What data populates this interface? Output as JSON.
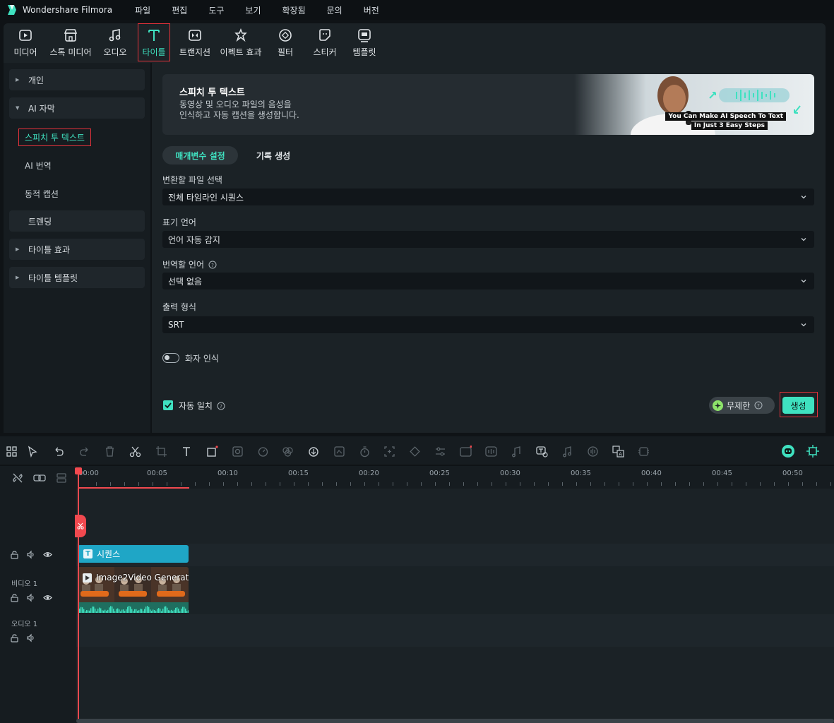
{
  "app": {
    "name": "Wondershare Filmora",
    "menu": [
      "파일",
      "편집",
      "도구",
      "보기",
      "확장됨",
      "문의",
      "버전"
    ]
  },
  "toolbar": {
    "items": [
      {
        "label": "미디어",
        "icon": "media-icon"
      },
      {
        "label": "스톡 미디어",
        "icon": "stock-media-icon"
      },
      {
        "label": "오디오",
        "icon": "music-note-icon"
      },
      {
        "label": "타이틀",
        "icon": "title-text-icon",
        "active": true
      },
      {
        "label": "트랜지션",
        "icon": "transition-icon"
      },
      {
        "label": "이펙트 효과",
        "icon": "effects-icon"
      },
      {
        "label": "필터",
        "icon": "filter-icon"
      },
      {
        "label": "스티커",
        "icon": "sticker-icon"
      },
      {
        "label": "템플릿",
        "icon": "template-icon"
      }
    ]
  },
  "sidebar": {
    "personal": "개인",
    "ai_captions": "AI 자막",
    "speech_to_text": "스피치 투 텍스트",
    "ai_translate": "AI 번역",
    "dynamic_caption": "동적 캡션",
    "trending": "트렌딩",
    "title_effects": "타이틀 효과",
    "title_templates": "타이틀 템플릿"
  },
  "banner": {
    "title": "스피치 투 텍스트",
    "desc_line1": "동영상 및 오디오 파일의 음성을",
    "desc_line2": "인식하고 자동 캡션을 생성합니다.",
    "caption1": "You Can Make AI Speech To Text",
    "caption2": "In Just  3 Easy Steps"
  },
  "tabs": {
    "params": "매개변수 설정",
    "history": "기록 생성"
  },
  "form": {
    "file_label": "변환할 파일 선택",
    "file_value": "전체 타임라인 시퀀스",
    "lang_label": "표기 언어",
    "lang_value": "언어 자동 감지",
    "translate_label": "번역할 언어",
    "translate_value": "선택 없음",
    "format_label": "출력 형식",
    "format_value": "SRT",
    "speaker_label": "화자 인식",
    "speaker_on": false,
    "automatch_label": "자동 일치",
    "automatch_checked": true,
    "unlimited": "무제한",
    "generate": "생성"
  },
  "timeline": {
    "ruler": [
      "00:00",
      "00:05",
      "00:10",
      "00:15",
      "00:20",
      "00:25",
      "00:30",
      "00:35",
      "00:40",
      "00:45",
      "00:50"
    ],
    "video_track": "비디오 1",
    "audio_track": "오디오 1",
    "title_clip": "시퀀스",
    "video_clip": "Image2Video Generati..."
  },
  "colors": {
    "accent": "#3fe1c0",
    "highlight_border": "#e5323b",
    "playhead": "#f1494f",
    "title_clip": "#1fa6c6"
  }
}
